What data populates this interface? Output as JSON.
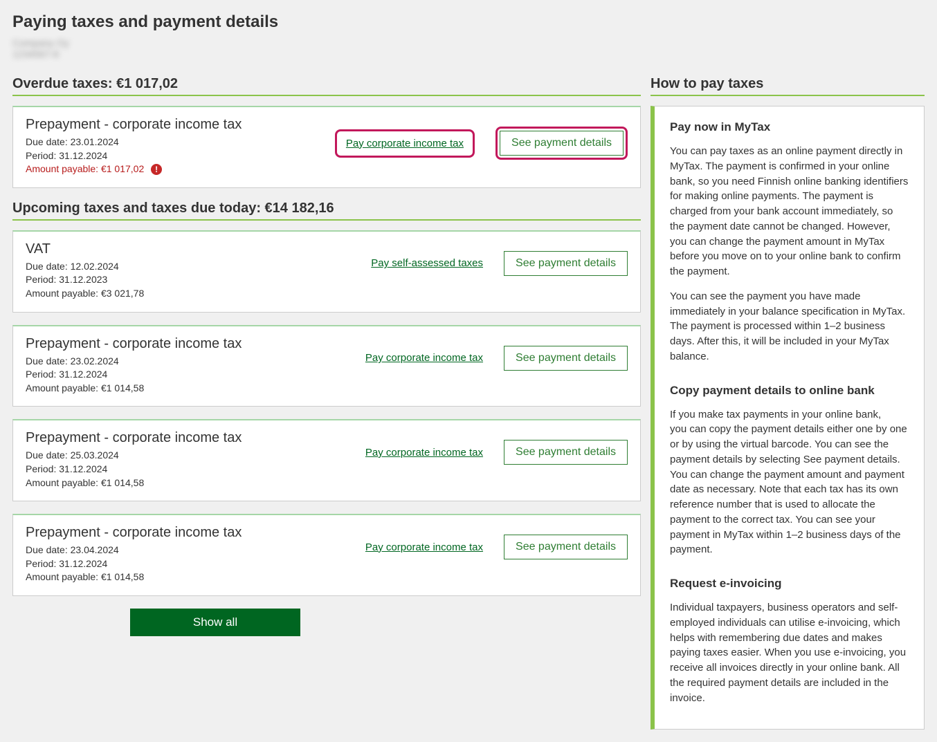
{
  "page_title": "Paying taxes and payment details",
  "entity_line1": "Company Oy",
  "entity_line2": "1234567-8",
  "overdue_heading": "Overdue taxes: €1 017,02",
  "upcoming_heading": "Upcoming taxes and taxes due today: €14 182,16",
  "labels": {
    "due_date": "Due date: ",
    "period": "Period: ",
    "amount_payable": "Amount payable: ",
    "see_details": "See payment details",
    "show_all": "Show all"
  },
  "overdue": [
    {
      "name": "Prepayment - corporate income tax",
      "due": "23.01.2024",
      "period": "31.12.2024",
      "amount": "€1 017,02",
      "pay_label": "Pay corporate income tax",
      "highlighted": true
    }
  ],
  "upcoming": [
    {
      "name": "VAT",
      "due": "12.02.2024",
      "period": "31.12.2023",
      "amount": "€3 021,78",
      "pay_label": "Pay self-assessed taxes"
    },
    {
      "name": "Prepayment - corporate income tax",
      "due": "23.02.2024",
      "period": "31.12.2024",
      "amount": "€1 014,58",
      "pay_label": "Pay corporate income tax"
    },
    {
      "name": "Prepayment - corporate income tax",
      "due": "25.03.2024",
      "period": "31.12.2024",
      "amount": "€1 014,58",
      "pay_label": "Pay corporate income tax"
    },
    {
      "name": "Prepayment - corporate income tax",
      "due": "23.04.2024",
      "period": "31.12.2024",
      "amount": "€1 014,58",
      "pay_label": "Pay corporate income tax"
    }
  ],
  "side": {
    "heading": "How to pay taxes",
    "s1_title": "Pay now in MyTax",
    "s1_p1": "You can pay taxes as an online payment directly in MyTax. The payment is confirmed in your online bank, so you need Finnish online banking identifiers for making online payments. The payment is charged from your bank account immediately, so the payment date cannot be changed. However, you can change the payment amount in MyTax before you move on to your online bank to confirm the payment.",
    "s1_p2": "You can see the payment you have made immediately in your balance specification in MyTax. The payment is processed within 1–2 business days. After this, it will be included in your MyTax balance.",
    "s2_title": "Copy payment details to online bank",
    "s2_p1": "If you make tax payments in your online bank,",
    "s2_p2": "you can copy the payment details either one by one or by using the virtual barcode. You can see the payment details by selecting See payment details. You can change the payment amount and payment date as necessary. Note that each tax has its own reference number that is used to allocate the payment to the correct tax. You can see your payment in MyTax within 1–2 business days of the payment.",
    "s3_title": "Request e-invoicing",
    "s3_p1": "Individual taxpayers, business operators and self-employed individuals can utilise e-invoicing, which helps with remembering due dates and makes paying taxes easier. When you use e-invoicing, you receive all invoices directly in your online bank. All the required payment details are included in the invoice."
  }
}
